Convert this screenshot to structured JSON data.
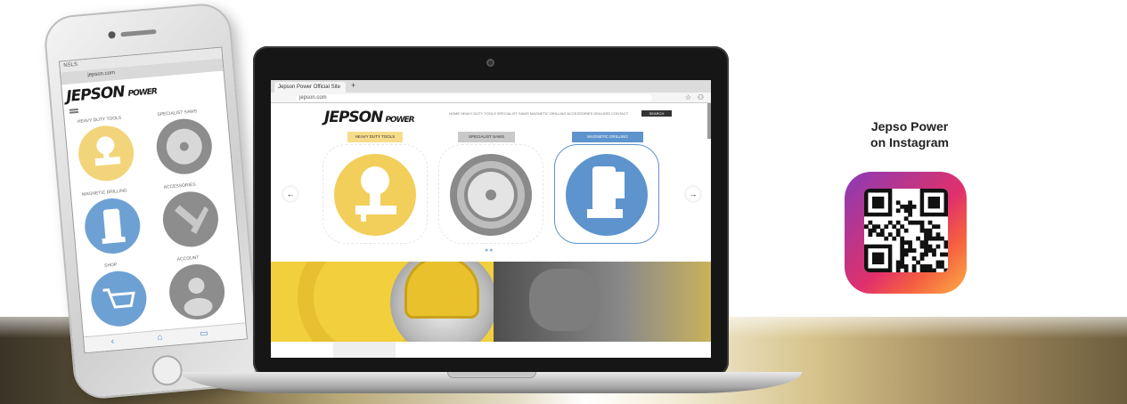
{
  "phone": {
    "status_text": "NSLS",
    "url_text": "jepson.com",
    "logo_text": "JEPSON",
    "logo_sub": "POWER",
    "labels": [
      "HEAVY DUTY TOOLS",
      "SPECIALIST SAWS",
      "MAGNETIC DRILLING",
      "ACCESSORIES",
      "SHOP",
      "ACCOUNT"
    ]
  },
  "laptop": {
    "tab_title": "Jepson Power Official Site",
    "new_tab": "+",
    "address": "jepson.com",
    "star_icon": "☆",
    "account_icon": "⚇",
    "logo_text": "JEPSON",
    "logo_sub": "POWER",
    "nav_text": "HOME   HEAVY DUTY TOOLS   SPECIALIST SAWS   MAGNETIC DRILLING   ACCESSORIES   DEALERS   CONTACT",
    "nav_button": "SEARCH",
    "categories": [
      "HEAVY DUTY TOOLS",
      "SPECIALIST SAWS",
      "MAGNETIC DRILLING"
    ],
    "arrow_left": "←",
    "arrow_right": "→",
    "dots": "●●"
  },
  "instagram": {
    "title_line1": "Jepso Power",
    "title_line2": "on Instagram"
  },
  "colors": {
    "yellow": "#f2cf5a",
    "gray": "#8a8a8a",
    "blue": "#5e94cd",
    "instagram_gradient": [
      "#8a3ab9",
      "#c13584",
      "#e1306c",
      "#f56040",
      "#fcaf45"
    ]
  }
}
